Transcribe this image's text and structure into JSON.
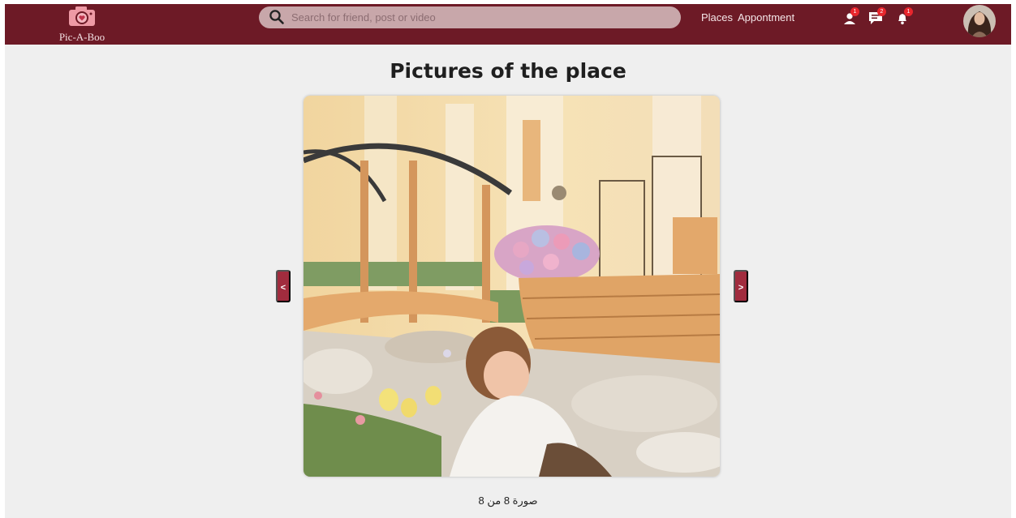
{
  "header": {
    "logo_text": "Pic-A-Boo",
    "search_placeholder": "Search for friend, post or video",
    "nav": {
      "places": "Places",
      "appointment": "Appontment"
    },
    "badges": {
      "friends": "1",
      "messages": "2",
      "notifications": "1"
    },
    "icons": [
      "camera-icon",
      "search-icon",
      "person-icon",
      "chat-icon",
      "bell-icon"
    ]
  },
  "main": {
    "title": "Pictures of the place",
    "prev_label": "<",
    "next_label": ">",
    "caption": "صورة 8 من 8",
    "current_image": 8,
    "total_images": 8
  },
  "colors": {
    "brand": "#6d1a26",
    "arrow": "#a12c3e",
    "badge": "#e8262d",
    "search_bg": "#c8a7aa",
    "page_bg": "#efefef"
  }
}
